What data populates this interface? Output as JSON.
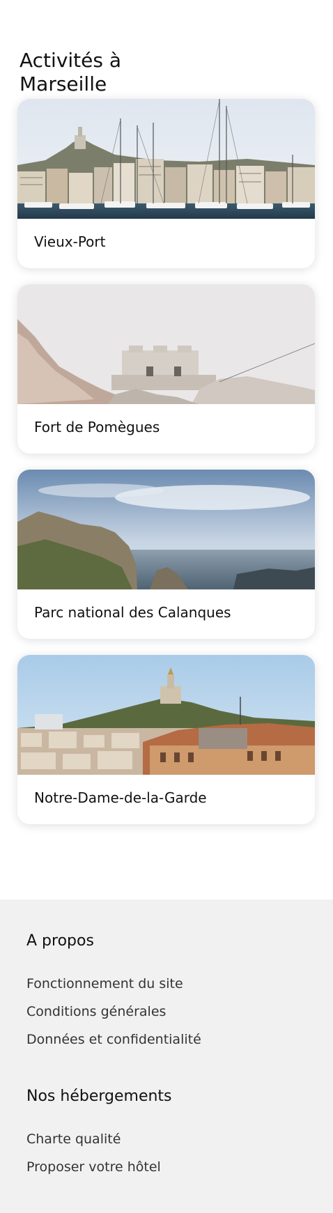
{
  "section": {
    "title": "Activités à Marseille"
  },
  "activities": [
    {
      "label": "Vieux-Port",
      "image": "vieux-port-photo"
    },
    {
      "label": "Fort de Pomègues",
      "image": "fort-de-pomegues-photo"
    },
    {
      "label": "Parc national des Calanques",
      "image": "calanques-photo"
    },
    {
      "label": "Notre-Dame-de-la-Garde",
      "image": "notre-dame-de-la-garde-photo"
    }
  ],
  "footer": {
    "about": {
      "heading": "A propos",
      "links": [
        "Fonctionnement du site",
        "Conditions générales",
        "Données et confidentialité"
      ]
    },
    "hebergements": {
      "heading": "Nos hébergements",
      "links": [
        "Charte qualité",
        "Proposer votre hôtel"
      ]
    }
  }
}
